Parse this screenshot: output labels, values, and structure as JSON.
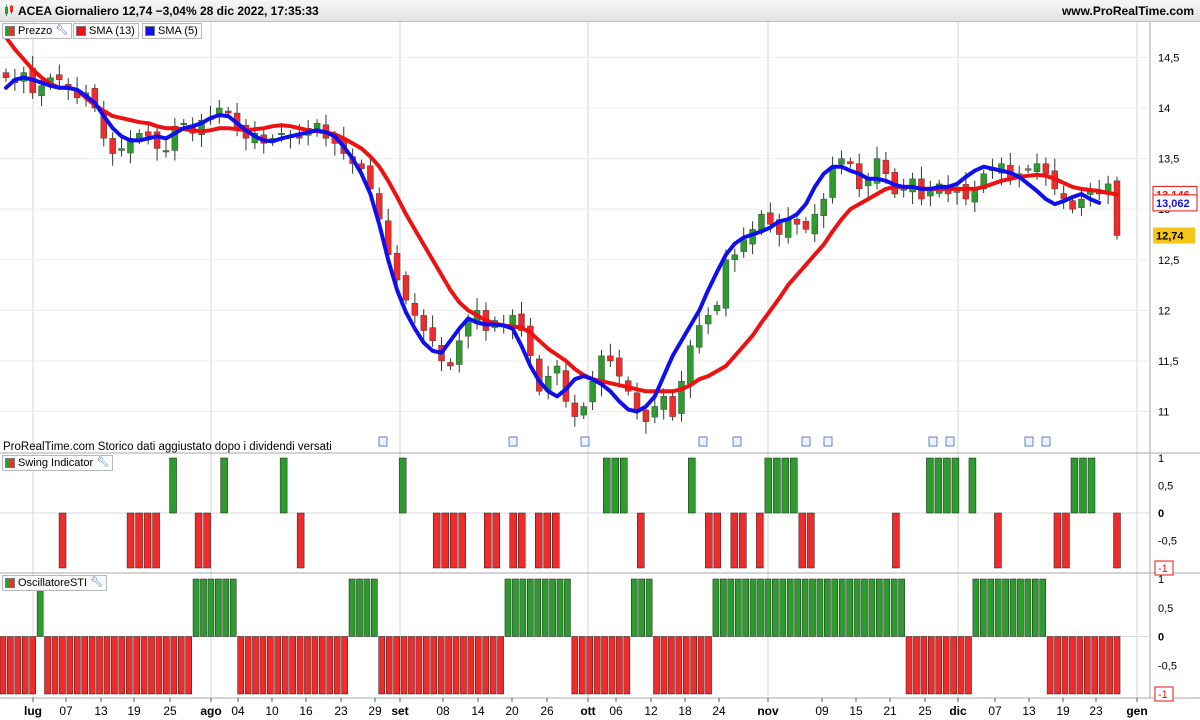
{
  "header": {
    "title": "ACEA Giornaliero 12,74 −3,04% 28 dic 2022, 17:35:33",
    "brand": "www.ProRealTime.com"
  },
  "legend": {
    "price": "Prezzo",
    "sma13": "SMA (13)",
    "sma5": "SMA (5)",
    "swing": "Swing Indicator",
    "sti": "OscillatoreSTI"
  },
  "footnote": "ProRealTime.com  Storico dati aggiustato dopo i dividendi versati",
  "colors": {
    "up": "#2e9b2e",
    "down": "#ef2b2b",
    "sma13": "#ee1111",
    "sma5": "#1010ee",
    "last_price_badge": "#f5c518"
  },
  "chart_data": [
    {
      "type": "candlestick",
      "title": "ACEA Giornaliero",
      "ylim": [
        10.6,
        14.85
      ],
      "y_ticks": [
        "14,5",
        "14",
        "13,5",
        "13",
        "12,5",
        "12",
        "11,5",
        "11"
      ],
      "y_tick_values": [
        14.5,
        14.0,
        13.5,
        13.0,
        12.5,
        12.0,
        11.5,
        11.0
      ],
      "x_labels": [
        "lug",
        "07",
        "13",
        "19",
        "25",
        "ago",
        "04",
        "10",
        "16",
        "23",
        "29",
        "set",
        "08",
        "14",
        "20",
        "26",
        "ott",
        "06",
        "12",
        "18",
        "24",
        "nov",
        "09",
        "15",
        "21",
        "25",
        "dic",
        "07",
        "13",
        "19",
        "23",
        "gen"
      ],
      "closes": [
        14.3,
        14.25,
        14.35,
        14.15,
        14.22,
        14.3,
        14.28,
        14.2,
        14.1,
        14.15,
        14.0,
        13.7,
        13.55,
        13.6,
        13.7,
        13.75,
        13.72,
        13.6,
        13.58,
        13.82,
        13.85,
        13.75,
        13.88,
        13.9,
        14.0,
        13.95,
        13.8,
        13.7,
        13.75,
        13.65,
        13.7,
        13.75,
        13.72,
        13.7,
        13.8,
        13.85,
        13.7,
        13.65,
        13.55,
        13.45,
        13.4,
        13.2,
        12.9,
        12.55,
        12.3,
        12.1,
        11.95,
        11.8,
        11.7,
        11.5,
        11.45,
        11.7,
        11.9,
        12.0,
        11.8,
        11.9,
        11.85,
        11.95,
        11.8,
        11.55,
        11.2,
        11.35,
        11.45,
        11.1,
        10.95,
        11.05,
        11.3,
        11.55,
        11.5,
        11.35,
        11.2,
        11.0,
        10.9,
        11.05,
        11.15,
        10.95,
        11.3,
        11.65,
        11.85,
        11.95,
        12.05,
        12.5,
        12.55,
        12.7,
        12.8,
        12.95,
        12.85,
        12.75,
        12.9,
        12.85,
        12.8,
        12.95,
        13.1,
        13.4,
        13.5,
        13.45,
        13.2,
        13.3,
        13.5,
        13.35,
        13.15,
        13.2,
        13.3,
        13.1,
        13.2,
        13.25,
        13.15,
        13.2,
        13.1,
        13.2,
        13.35,
        13.4,
        13.45,
        13.3,
        13.35,
        13.4,
        13.45,
        13.35,
        13.2,
        13.1,
        13.0,
        13.1,
        13.2,
        13.15,
        13.25,
        12.74
      ],
      "sma13": [
        14.7,
        14.58,
        14.48,
        14.38,
        14.3,
        14.24,
        14.2,
        14.2,
        14.18,
        14.1,
        14.03,
        13.97,
        13.92,
        13.9,
        13.88,
        13.86,
        13.85,
        13.82,
        13.8,
        13.8,
        13.79,
        13.78,
        13.77,
        13.78,
        13.8,
        13.8,
        13.79,
        13.78,
        13.79,
        13.8,
        13.82,
        13.83,
        13.82,
        13.8,
        13.78,
        13.77,
        13.76,
        13.74,
        13.7,
        13.65,
        13.6,
        13.52,
        13.42,
        13.28,
        13.12,
        12.95,
        12.8,
        12.65,
        12.5,
        12.35,
        12.2,
        12.08,
        12.0,
        11.95,
        11.9,
        11.87,
        11.85,
        11.84,
        11.83,
        11.78,
        11.7,
        11.62,
        11.56,
        11.5,
        11.42,
        11.36,
        11.32,
        11.3,
        11.28,
        11.26,
        11.24,
        11.22,
        11.2,
        11.2,
        11.2,
        11.2,
        11.22,
        11.26,
        11.32,
        11.35,
        11.4,
        11.45,
        11.55,
        11.65,
        11.75,
        11.88,
        12.0,
        12.12,
        12.25,
        12.35,
        12.45,
        12.55,
        12.65,
        12.78,
        12.9,
        13.0,
        13.05,
        13.1,
        13.15,
        13.2,
        13.22,
        13.22,
        13.22,
        13.2,
        13.2,
        13.2,
        13.2,
        13.2,
        13.2,
        13.2,
        13.22,
        13.25,
        13.28,
        13.3,
        13.32,
        13.33,
        13.34,
        13.33,
        13.3,
        13.26,
        13.22,
        13.2,
        13.19,
        13.18,
        13.16,
        13.146
      ],
      "sma5": [
        14.2,
        14.28,
        14.3,
        14.28,
        14.25,
        14.22,
        14.2,
        14.2,
        14.18,
        14.12,
        14.05,
        13.92,
        13.8,
        13.72,
        13.68,
        13.68,
        13.7,
        13.72,
        13.7,
        13.75,
        13.8,
        13.82,
        13.85,
        13.9,
        13.93,
        13.92,
        13.85,
        13.78,
        13.72,
        13.68,
        13.67,
        13.7,
        13.72,
        13.74,
        13.76,
        13.78,
        13.76,
        13.72,
        13.62,
        13.5,
        13.35,
        13.15,
        12.85,
        12.5,
        12.2,
        11.98,
        11.82,
        11.68,
        11.6,
        11.58,
        11.7,
        11.82,
        11.92,
        11.88,
        11.86,
        11.86,
        11.85,
        11.82,
        11.65,
        11.45,
        11.3,
        11.2,
        11.15,
        11.22,
        11.32,
        11.35,
        11.32,
        11.27,
        11.2,
        11.1,
        11.02,
        11.0,
        11.05,
        11.15,
        11.35,
        11.55,
        11.7,
        11.85,
        12.0,
        12.2,
        12.38,
        12.55,
        12.66,
        12.72,
        12.75,
        12.78,
        12.82,
        12.88,
        12.9,
        12.95,
        13.05,
        13.22,
        13.35,
        13.42,
        13.42,
        13.38,
        13.35,
        13.3,
        13.3,
        13.28,
        13.24,
        13.22,
        13.22,
        13.2,
        13.2,
        13.22,
        13.22,
        13.25,
        13.32,
        13.38,
        13.42,
        13.4,
        13.38,
        13.36,
        13.32,
        13.25,
        13.18,
        13.1,
        13.05,
        13.08,
        13.12,
        13.15,
        13.1,
        13.062
      ],
      "last_price": "12,74",
      "last_sma13": "13,146",
      "last_sma5": "13,062"
    },
    {
      "type": "bar",
      "title": "Swing Indicator",
      "ylim": [
        -1,
        1
      ],
      "y_ticks": [
        "1",
        "0,5",
        "0",
        "-0,5",
        "-1"
      ],
      "values": [
        0,
        0,
        0,
        0,
        0,
        0,
        0,
        -1,
        0,
        0,
        0,
        0,
        0,
        0,
        0,
        -1,
        -1,
        -1,
        -1,
        0,
        1,
        0,
        0,
        -1,
        -1,
        0,
        1,
        0,
        0,
        0,
        0,
        0,
        0,
        1,
        0,
        -1,
        0,
        0,
        0,
        0,
        0,
        0,
        0,
        0,
        0,
        0,
        0,
        1,
        0,
        0,
        0,
        -1,
        -1,
        -1,
        -1,
        0,
        0,
        -1,
        -1,
        0,
        -1,
        -1,
        0,
        -1,
        -1,
        -1,
        0,
        0,
        0,
        0,
        0,
        1,
        1,
        1,
        0,
        -1,
        0,
        0,
        0,
        0,
        0,
        1,
        0,
        -1,
        -1,
        0,
        -1,
        -1,
        0,
        -1,
        1,
        1,
        1,
        1,
        -1,
        -1,
        0,
        0,
        0,
        0,
        0,
        0,
        0,
        0,
        0,
        -1,
        0,
        0,
        0,
        1,
        1,
        1,
        1,
        0,
        1,
        0,
        0,
        -1,
        0,
        0,
        0,
        0,
        0,
        0,
        -1,
        -1,
        1,
        1,
        1,
        0,
        0,
        -1
      ],
      "last_badge": "-1"
    },
    {
      "type": "bar",
      "title": "OscillatoreSTI",
      "ylim": [
        -1,
        1
      ],
      "y_ticks": [
        "1",
        "0,5",
        "0",
        "-0,5",
        "-1"
      ],
      "values": [
        -1,
        -1,
        -1,
        -1,
        -1,
        1,
        -1,
        -1,
        -1,
        -1,
        -1,
        -1,
        -1,
        -1,
        -1,
        -1,
        -1,
        -1,
        -1,
        -1,
        -1,
        -1,
        -1,
        -1,
        -1,
        -1,
        1,
        1,
        1,
        1,
        1,
        1,
        -1,
        -1,
        -1,
        -1,
        -1,
        -1,
        -1,
        -1,
        -1,
        -1,
        -1,
        -1,
        -1,
        -1,
        -1,
        1,
        1,
        1,
        1,
        -1,
        -1,
        -1,
        -1,
        -1,
        -1,
        -1,
        -1,
        -1,
        -1,
        -1,
        -1,
        -1,
        -1,
        -1,
        -1,
        -1,
        1,
        1,
        1,
        1,
        1,
        1,
        1,
        1,
        1,
        -1,
        -1,
        -1,
        -1,
        -1,
        -1,
        -1,
        -1,
        1,
        1,
        1,
        -1,
        -1,
        -1,
        -1,
        -1,
        -1,
        -1,
        -1,
        1,
        1,
        1,
        1,
        1,
        1,
        1,
        1,
        1,
        1,
        1,
        1,
        1,
        1,
        1,
        1,
        1,
        1,
        1,
        1,
        1,
        1,
        1,
        1,
        1,
        1,
        -1,
        -1,
        -1,
        -1,
        -1,
        -1,
        -1,
        -1,
        -1,
        1,
        1,
        1,
        1,
        1,
        1,
        1,
        1,
        1,
        1,
        -1,
        -1,
        -1,
        -1,
        -1,
        -1,
        -1,
        -1,
        -1,
        -1
      ],
      "last_badge": "-1"
    }
  ]
}
